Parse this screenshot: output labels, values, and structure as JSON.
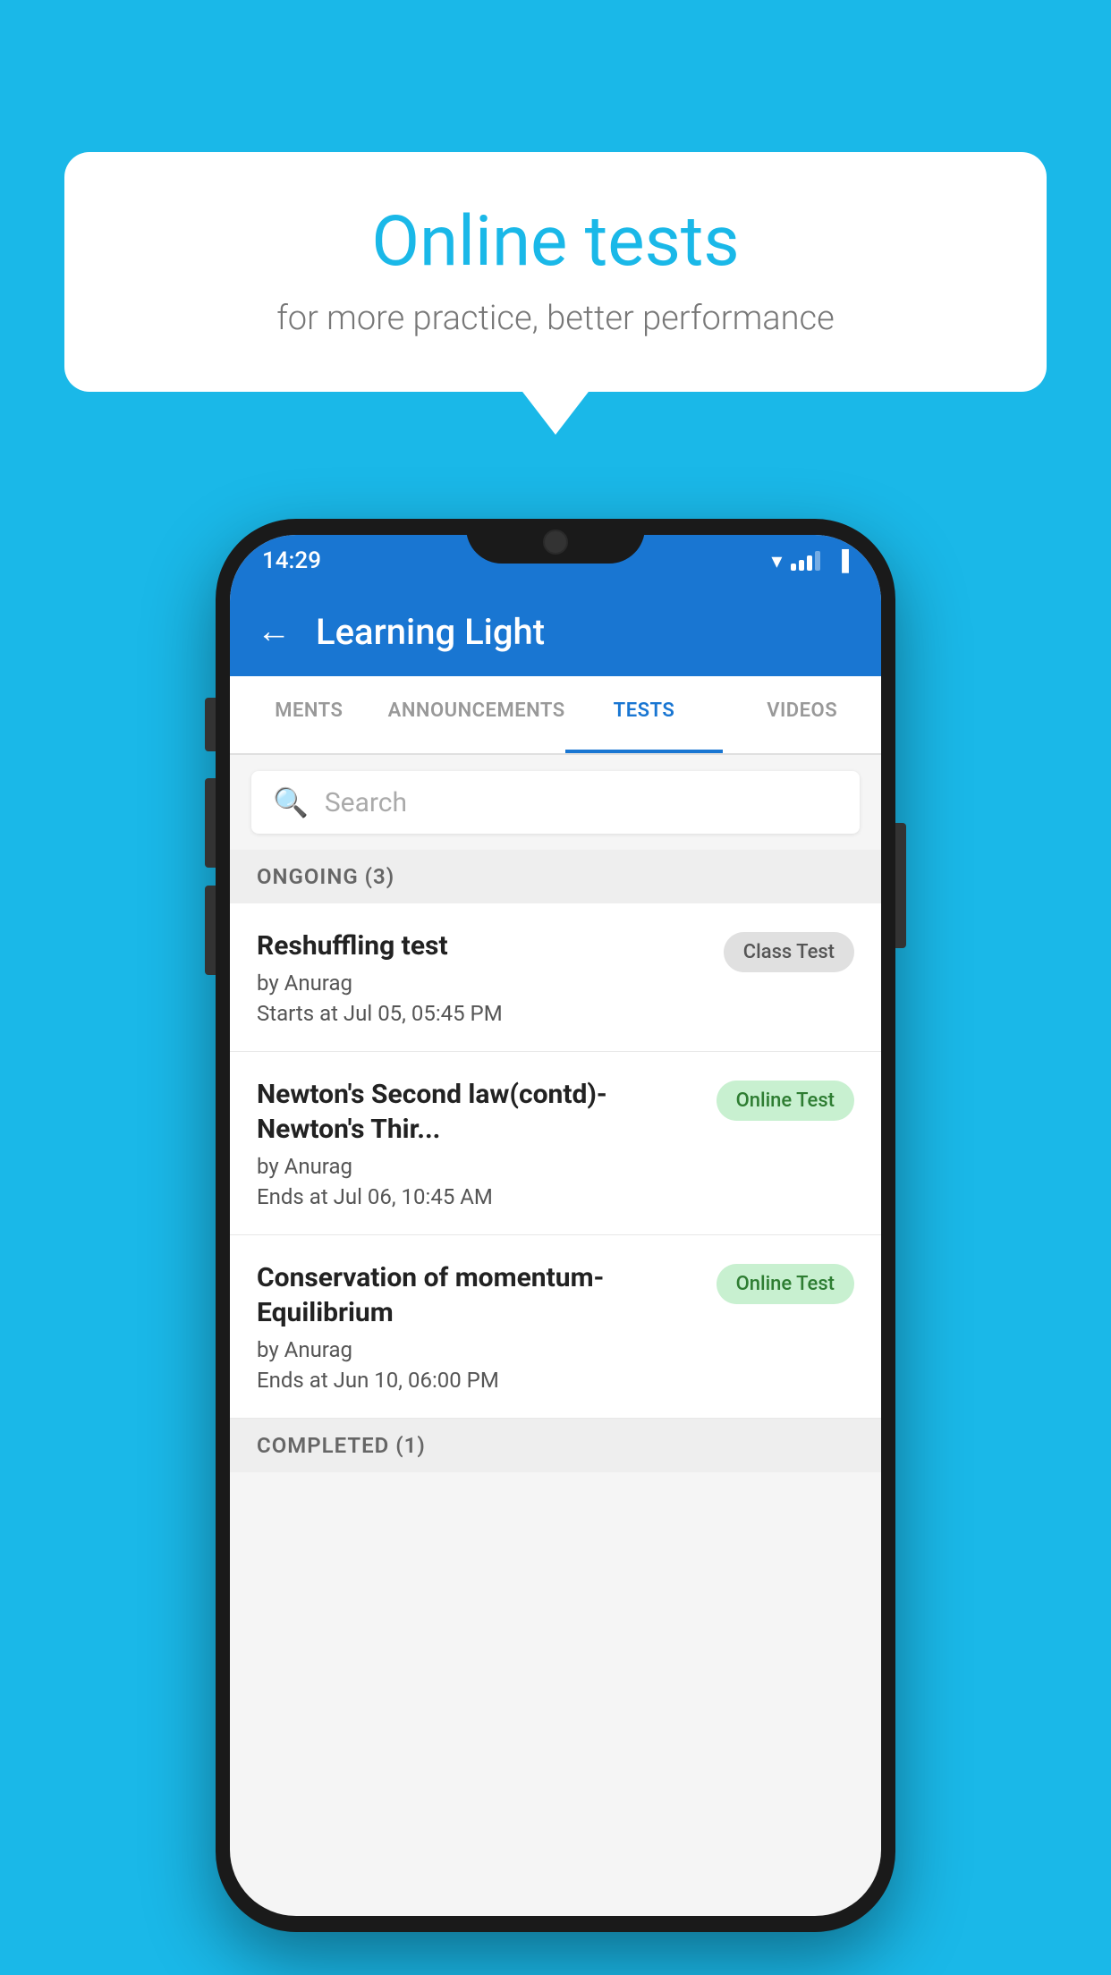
{
  "background": {
    "color": "#1ab8e8"
  },
  "speech_bubble": {
    "title": "Online tests",
    "subtitle": "for more practice, better performance"
  },
  "phone": {
    "status_bar": {
      "time": "14:29"
    },
    "header": {
      "title": "Learning Light",
      "back_label": "←"
    },
    "tabs": [
      {
        "label": "MENTS",
        "active": false
      },
      {
        "label": "ANNOUNCEMENTS",
        "active": false
      },
      {
        "label": "TESTS",
        "active": true
      },
      {
        "label": "VIDEOS",
        "active": false
      }
    ],
    "search": {
      "placeholder": "Search"
    },
    "ongoing_section": {
      "header": "ONGOING (3)"
    },
    "test_items": [
      {
        "name": "Reshuffling test",
        "author": "by Anurag",
        "date": "Starts at  Jul 05, 05:45 PM",
        "badge": "Class Test",
        "badge_type": "class"
      },
      {
        "name": "Newton's Second law(contd)-Newton's Thir...",
        "author": "by Anurag",
        "date": "Ends at  Jul 06, 10:45 AM",
        "badge": "Online Test",
        "badge_type": "online"
      },
      {
        "name": "Conservation of momentum-Equilibrium",
        "author": "by Anurag",
        "date": "Ends at  Jun 10, 06:00 PM",
        "badge": "Online Test",
        "badge_type": "online"
      }
    ],
    "completed_section": {
      "header": "COMPLETED (1)"
    }
  }
}
